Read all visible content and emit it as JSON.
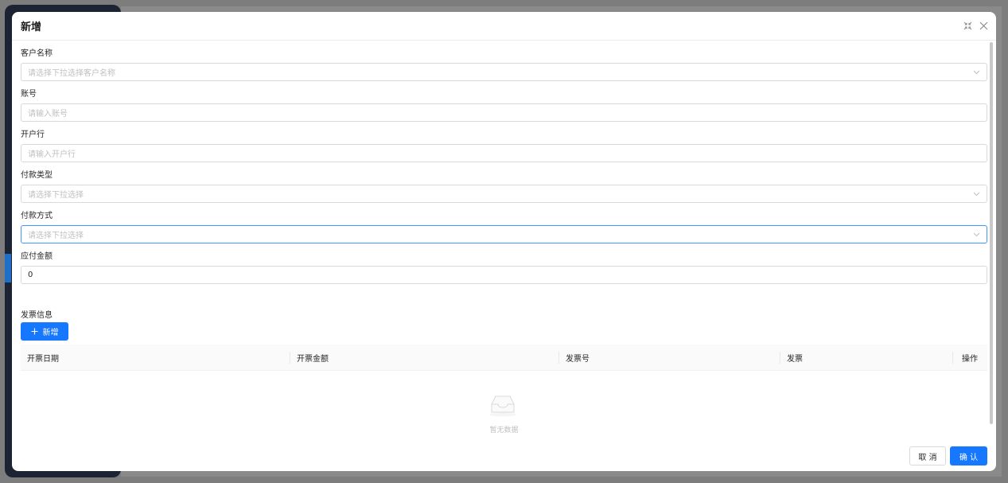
{
  "modal": {
    "title": "新增",
    "shrink_icon": "collapse-arrows-icon",
    "close_icon": "close-icon"
  },
  "form": {
    "customer": {
      "label": "客户名称",
      "placeholder": "请选择下拉选择客户名称"
    },
    "account": {
      "label": "账号",
      "placeholder": "请输入账号"
    },
    "bank": {
      "label": "开户行",
      "placeholder": "请输入开户行"
    },
    "payment_type": {
      "label": "付款类型",
      "placeholder": "请选择下拉选择"
    },
    "payment_method": {
      "label": "付款方式",
      "placeholder": "请选择下拉选择"
    },
    "amount": {
      "label": "应付金额",
      "value": "0"
    }
  },
  "invoice": {
    "section_label": "发票信息",
    "add_button": "新增",
    "columns": [
      "开票日期",
      "开票金额",
      "发票号",
      "发票",
      "操作"
    ],
    "empty_text": "暂无数据"
  },
  "footer": {
    "cancel": "取 消",
    "ok": "确 认"
  },
  "colors": {
    "primary": "#1677ff",
    "focus_border": "#4096ff"
  }
}
